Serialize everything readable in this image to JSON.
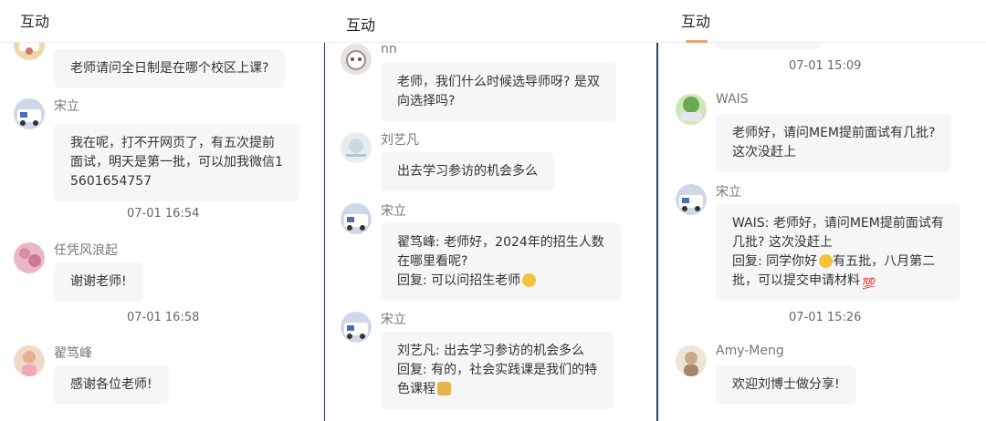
{
  "panels": [
    {
      "title": "互动",
      "items": [
        {
          "text_lines": [
            "老师请问全日制是在哪个校区上课?"
          ]
        },
        {
          "user": "宋立",
          "text_lines": [
            "我在呢，打不开网页了，有五次提前",
            "面试，明天是第一批，可以加我微信1",
            "5601654757"
          ]
        },
        {
          "time": "07-01 16:54"
        },
        {
          "user": "任凭风浪起",
          "text_lines": [
            "谢谢老师!"
          ]
        },
        {
          "time": "07-01 16:58"
        },
        {
          "user": "翟笃峰",
          "text_lines": [
            "感谢各位老师!"
          ]
        }
      ]
    },
    {
      "title": "互动",
      "items": [
        {
          "user": "nn",
          "text_lines": [
            "老师，我们什么时候选导师呀? 是双",
            "向选择吗?"
          ]
        },
        {
          "user": "刘艺凡",
          "text_lines": [
            "出去学习参访的机会多么"
          ]
        },
        {
          "user": "宋立",
          "text_lines": [
            "翟笃峰: 老师好，2024年的招生人数",
            "在哪里看呢?",
            "回复: 可以问招生老师"
          ]
        },
        {
          "user": "宋立",
          "text_lines": [
            "刘艺凡: 出去学习参访的机会多么",
            "回复: 有的，社会实践课是我们的特",
            "色课程"
          ]
        }
      ]
    },
    {
      "title": "互动",
      "items": [
        {
          "time": "07-01 15:09"
        },
        {
          "user": "WAIS",
          "text_lines": [
            "老师好，请问MEM提前面试有几批?",
            "这次没赶上"
          ]
        },
        {
          "user": "宋立",
          "text_lines": [
            "WAIS: 老师好，请问MEM提前面试有",
            "几批? 这次没赶上",
            "回复: 同学你好",
            "有五批，八月第二",
            "批，可以提交申请材料"
          ]
        },
        {
          "time": "07-01 15:26"
        },
        {
          "user": "Amy-Meng",
          "text_lines": [
            "欢迎刘博士做分享!"
          ]
        }
      ]
    }
  ],
  "icons": {
    "emoji_smile": "grinning-face-emoji",
    "emoji_gift": "gift-emoji",
    "emoji_hundred": "hundred-points-emoji",
    "hundred_glyph": "💯"
  },
  "colors": {
    "divider": "#2c3d6b",
    "bubble": "#f5f6f8",
    "tab_underline": "#f0a070"
  }
}
